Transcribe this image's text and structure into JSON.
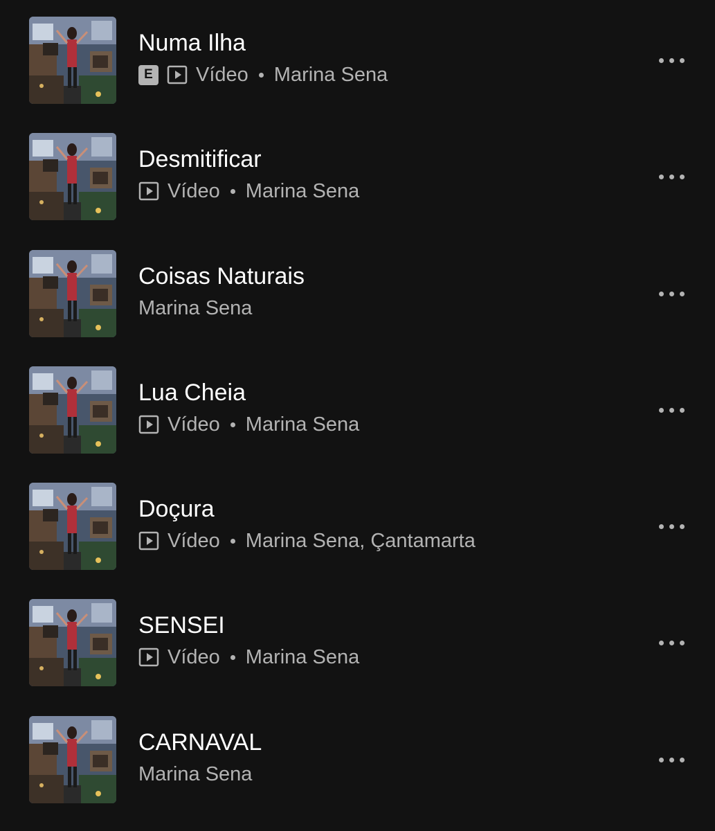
{
  "tracks": [
    {
      "title": "Numa Ilha",
      "explicit": true,
      "explicit_label": "E",
      "video": true,
      "video_label": "Vídeo",
      "artist": "Marina Sena"
    },
    {
      "title": "Desmitificar",
      "explicit": false,
      "video": true,
      "video_label": "Vídeo",
      "artist": "Marina Sena"
    },
    {
      "title": "Coisas Naturais",
      "explicit": false,
      "video": false,
      "artist": "Marina Sena"
    },
    {
      "title": "Lua Cheia",
      "explicit": false,
      "video": true,
      "video_label": "Vídeo",
      "artist": "Marina Sena"
    },
    {
      "title": "Doçura",
      "explicit": false,
      "video": true,
      "video_label": "Vídeo",
      "artist": "Marina Sena, Çantamarta"
    },
    {
      "title": "SENSEI",
      "explicit": false,
      "video": true,
      "video_label": "Vídeo",
      "artist": "Marina Sena"
    },
    {
      "title": "CARNAVAL",
      "explicit": false,
      "video": false,
      "artist": "Marina Sena"
    }
  ],
  "icons": {
    "video": "video-play-icon",
    "more": "more-options-icon",
    "explicit": "explicit-badge"
  },
  "colors": {
    "background": "#121212",
    "primary_text": "#ffffff",
    "secondary_text": "#b3b3b3"
  }
}
